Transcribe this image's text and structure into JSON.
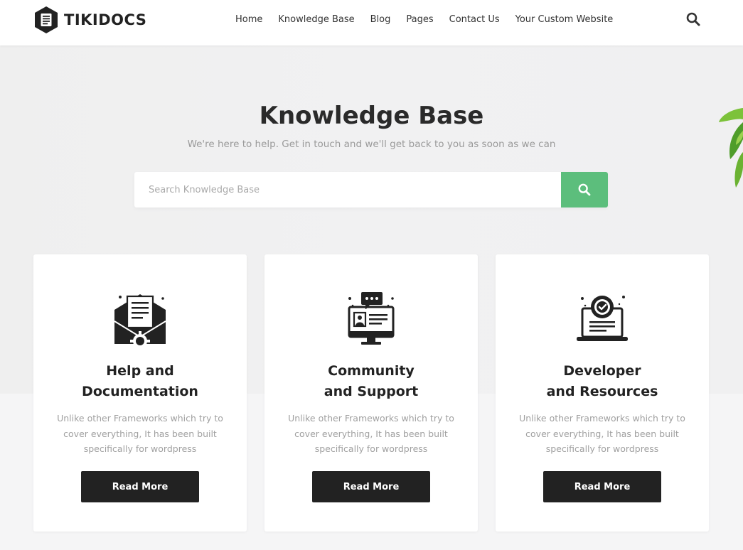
{
  "header": {
    "logo_text": "TIKIDOCS",
    "nav": [
      {
        "label": "Home"
      },
      {
        "label": "Knowledge Base"
      },
      {
        "label": "Blog"
      },
      {
        "label": "Pages"
      },
      {
        "label": "Contact Us"
      },
      {
        "label": "Your Custom Website"
      }
    ],
    "search_icon": "search-icon"
  },
  "hero": {
    "title": "Knowledge Base",
    "subtitle": "We're here to help. Get in touch and we'll get back to you as soon as we can",
    "search": {
      "placeholder": "Search Knowledge Base",
      "value": "",
      "button_icon": "search-icon"
    }
  },
  "cards": [
    {
      "icon": "envelope-gear-icon",
      "title_line1": "Help and",
      "title_line2": "Documentation",
      "text": "Unlike other Frameworks which try to cover everything, It has been built specifically for wordpress",
      "button": "Read More"
    },
    {
      "icon": "monitor-chat-icon",
      "title_line1": "Community",
      "title_line2": "and Support",
      "text": "Unlike other Frameworks which try to cover everything, It has been built specifically for wordpress",
      "button": "Read More"
    },
    {
      "icon": "laptop-check-icon",
      "title_line1": "Developer",
      "title_line2": "and Resources",
      "text": "Unlike other Frameworks which try to cover everything, It has been built specifically for wordpress",
      "button": "Read More"
    }
  ],
  "colors": {
    "accent": "#5cbe7c",
    "dark": "#222222",
    "muted_text": "#a0a0a0"
  }
}
